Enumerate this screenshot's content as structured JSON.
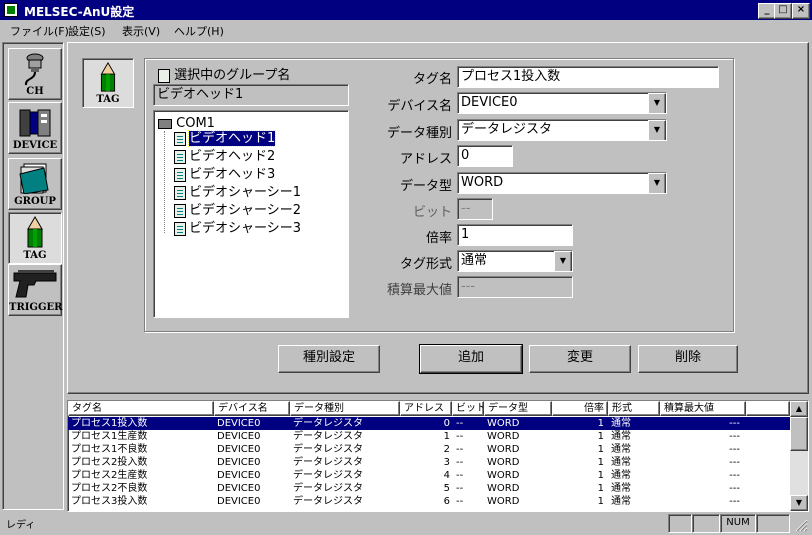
{
  "window": {
    "title": "MELSEC-AnU設定"
  },
  "menu": [
    "ファイル(F)",
    "設定(S)",
    "表示(V)",
    "ヘルプ(H)"
  ],
  "toolbar": [
    {
      "id": "ch",
      "label": "CH",
      "icon": "plug-icon"
    },
    {
      "id": "device",
      "label": "DEVICE",
      "icon": "device-icon"
    },
    {
      "id": "group",
      "label": "GROUP",
      "icon": "folder-icon"
    },
    {
      "id": "tag",
      "label": "TAG",
      "icon": "pencil-icon",
      "pressed": true
    },
    {
      "id": "trigger",
      "label": "TRIGGER",
      "icon": "pistol-icon"
    }
  ],
  "panel": {
    "mode_label": "TAG",
    "group_header": "選択中のグループ名",
    "group_name": "ビデオヘッド1",
    "tree": {
      "root": "COM1",
      "items": [
        "ビデオヘッド1",
        "ビデオヘッド2",
        "ビデオヘッド3",
        "ビデオシャーシー1",
        "ビデオシャーシー2",
        "ビデオシャーシー3"
      ],
      "selected": 0
    },
    "form": {
      "tag_name_label": "タグ名",
      "tag_name": "プロセス1投入数",
      "device_label": "デバイス名",
      "device": "DEVICE0",
      "data_kind_label": "データ種別",
      "data_kind": "データレジスタ",
      "address_label": "アドレス",
      "address": "0",
      "data_type_label": "データ型",
      "data_type": "WORD",
      "bit_label": "ビット",
      "bit": "--",
      "scale_label": "倍率",
      "scale": "1",
      "tag_format_label": "タグ形式",
      "tag_format": "通常",
      "max_label": "積算最大値",
      "max": "---"
    },
    "buttons": {
      "kind_setting": "種別設定",
      "add": "追加",
      "change": "変更",
      "delete": "削除"
    }
  },
  "table": {
    "headers": [
      "タグ名",
      "デバイス名",
      "データ種別",
      "アドレス",
      "ビット",
      "データ型",
      "倍率",
      "形式",
      "積算最大値"
    ],
    "rows": [
      [
        "プロセス1投入数",
        "DEVICE0",
        "データレジスタ",
        "0",
        "--",
        "WORD",
        "1",
        "通常",
        "---"
      ],
      [
        "プロセス1生産数",
        "DEVICE0",
        "データレジスタ",
        "1",
        "--",
        "WORD",
        "1",
        "通常",
        "---"
      ],
      [
        "プロセス1不良数",
        "DEVICE0",
        "データレジスタ",
        "2",
        "--",
        "WORD",
        "1",
        "通常",
        "---"
      ],
      [
        "プロセス2投入数",
        "DEVICE0",
        "データレジスタ",
        "3",
        "--",
        "WORD",
        "1",
        "通常",
        "---"
      ],
      [
        "プロセス2生産数",
        "DEVICE0",
        "データレジスタ",
        "4",
        "--",
        "WORD",
        "1",
        "通常",
        "---"
      ],
      [
        "プロセス2不良数",
        "DEVICE0",
        "データレジスタ",
        "5",
        "--",
        "WORD",
        "1",
        "通常",
        "---"
      ],
      [
        "プロセス3投入数",
        "DEVICE0",
        "データレジスタ",
        "6",
        "--",
        "WORD",
        "1",
        "通常",
        "---"
      ]
    ],
    "selected": 0
  },
  "status": {
    "text": "レディ",
    "num": "NUM"
  },
  "colors": {
    "titlebar": "#000080",
    "face": "#c0c0c0",
    "selection": "#000080"
  }
}
